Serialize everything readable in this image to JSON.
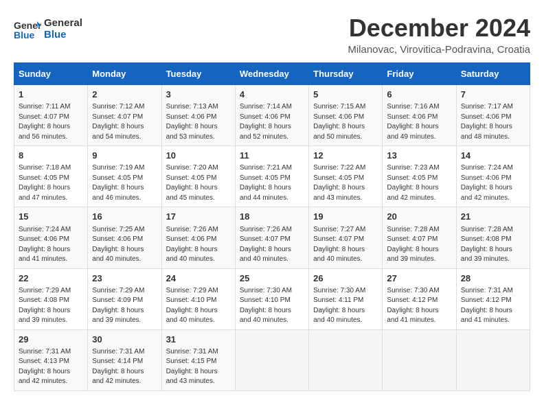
{
  "header": {
    "logo_line1": "General",
    "logo_line2": "Blue",
    "month": "December 2024",
    "location": "Milanovac, Virovitica-Podravina, Croatia"
  },
  "weekdays": [
    "Sunday",
    "Monday",
    "Tuesday",
    "Wednesday",
    "Thursday",
    "Friday",
    "Saturday"
  ],
  "weeks": [
    [
      {
        "day": "1",
        "sunrise": "7:11 AM",
        "sunset": "4:07 PM",
        "daylight": "8 hours and 56 minutes."
      },
      {
        "day": "2",
        "sunrise": "7:12 AM",
        "sunset": "4:07 PM",
        "daylight": "8 hours and 54 minutes."
      },
      {
        "day": "3",
        "sunrise": "7:13 AM",
        "sunset": "4:06 PM",
        "daylight": "8 hours and 53 minutes."
      },
      {
        "day": "4",
        "sunrise": "7:14 AM",
        "sunset": "4:06 PM",
        "daylight": "8 hours and 52 minutes."
      },
      {
        "day": "5",
        "sunrise": "7:15 AM",
        "sunset": "4:06 PM",
        "daylight": "8 hours and 50 minutes."
      },
      {
        "day": "6",
        "sunrise": "7:16 AM",
        "sunset": "4:06 PM",
        "daylight": "8 hours and 49 minutes."
      },
      {
        "day": "7",
        "sunrise": "7:17 AM",
        "sunset": "4:06 PM",
        "daylight": "8 hours and 48 minutes."
      }
    ],
    [
      {
        "day": "8",
        "sunrise": "7:18 AM",
        "sunset": "4:05 PM",
        "daylight": "8 hours and 47 minutes."
      },
      {
        "day": "9",
        "sunrise": "7:19 AM",
        "sunset": "4:05 PM",
        "daylight": "8 hours and 46 minutes."
      },
      {
        "day": "10",
        "sunrise": "7:20 AM",
        "sunset": "4:05 PM",
        "daylight": "8 hours and 45 minutes."
      },
      {
        "day": "11",
        "sunrise": "7:21 AM",
        "sunset": "4:05 PM",
        "daylight": "8 hours and 44 minutes."
      },
      {
        "day": "12",
        "sunrise": "7:22 AM",
        "sunset": "4:05 PM",
        "daylight": "8 hours and 43 minutes."
      },
      {
        "day": "13",
        "sunrise": "7:23 AM",
        "sunset": "4:05 PM",
        "daylight": "8 hours and 42 minutes."
      },
      {
        "day": "14",
        "sunrise": "7:24 AM",
        "sunset": "4:06 PM",
        "daylight": "8 hours and 42 minutes."
      }
    ],
    [
      {
        "day": "15",
        "sunrise": "7:24 AM",
        "sunset": "4:06 PM",
        "daylight": "8 hours and 41 minutes."
      },
      {
        "day": "16",
        "sunrise": "7:25 AM",
        "sunset": "4:06 PM",
        "daylight": "8 hours and 40 minutes."
      },
      {
        "day": "17",
        "sunrise": "7:26 AM",
        "sunset": "4:06 PM",
        "daylight": "8 hours and 40 minutes."
      },
      {
        "day": "18",
        "sunrise": "7:26 AM",
        "sunset": "4:07 PM",
        "daylight": "8 hours and 40 minutes."
      },
      {
        "day": "19",
        "sunrise": "7:27 AM",
        "sunset": "4:07 PM",
        "daylight": "8 hours and 40 minutes."
      },
      {
        "day": "20",
        "sunrise": "7:28 AM",
        "sunset": "4:07 PM",
        "daylight": "8 hours and 39 minutes."
      },
      {
        "day": "21",
        "sunrise": "7:28 AM",
        "sunset": "4:08 PM",
        "daylight": "8 hours and 39 minutes."
      }
    ],
    [
      {
        "day": "22",
        "sunrise": "7:29 AM",
        "sunset": "4:08 PM",
        "daylight": "8 hours and 39 minutes."
      },
      {
        "day": "23",
        "sunrise": "7:29 AM",
        "sunset": "4:09 PM",
        "daylight": "8 hours and 39 minutes."
      },
      {
        "day": "24",
        "sunrise": "7:29 AM",
        "sunset": "4:10 PM",
        "daylight": "8 hours and 40 minutes."
      },
      {
        "day": "25",
        "sunrise": "7:30 AM",
        "sunset": "4:10 PM",
        "daylight": "8 hours and 40 minutes."
      },
      {
        "day": "26",
        "sunrise": "7:30 AM",
        "sunset": "4:11 PM",
        "daylight": "8 hours and 40 minutes."
      },
      {
        "day": "27",
        "sunrise": "7:30 AM",
        "sunset": "4:12 PM",
        "daylight": "8 hours and 41 minutes."
      },
      {
        "day": "28",
        "sunrise": "7:31 AM",
        "sunset": "4:12 PM",
        "daylight": "8 hours and 41 minutes."
      }
    ],
    [
      {
        "day": "29",
        "sunrise": "7:31 AM",
        "sunset": "4:13 PM",
        "daylight": "8 hours and 42 minutes."
      },
      {
        "day": "30",
        "sunrise": "7:31 AM",
        "sunset": "4:14 PM",
        "daylight": "8 hours and 42 minutes."
      },
      {
        "day": "31",
        "sunrise": "7:31 AM",
        "sunset": "4:15 PM",
        "daylight": "8 hours and 43 minutes."
      },
      null,
      null,
      null,
      null
    ]
  ]
}
